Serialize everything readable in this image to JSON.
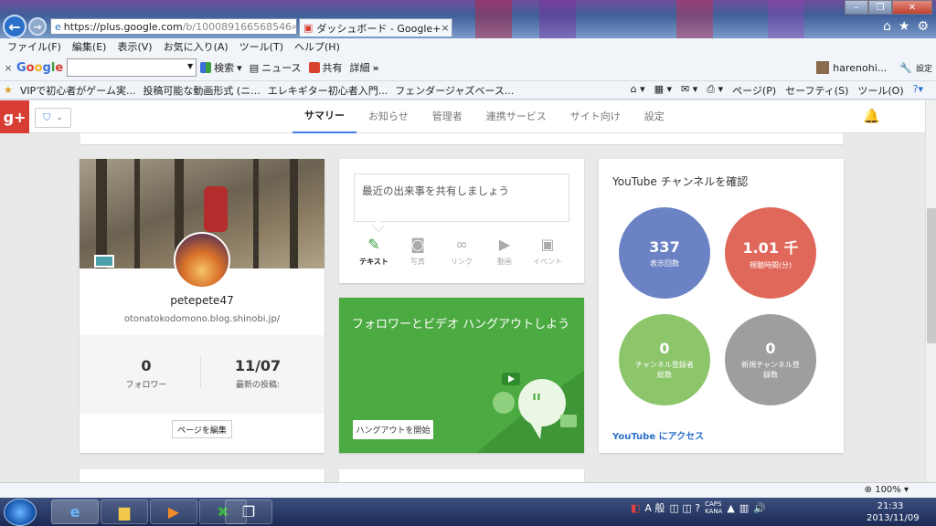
{
  "browser": {
    "address_url_main": "https://plus.google.com",
    "address_url_rest": "/b/100089166568546",
    "tab_title": "ダッシュボード - Google+",
    "menu": [
      "ファイル(F)",
      "編集(E)",
      "表示(V)",
      "お気に入り(A)",
      "ツール(T)",
      "ヘルプ(H)"
    ],
    "toolbar": {
      "search_label": "検索",
      "news_label": "ニュース",
      "share_label": "共有",
      "details_label": "詳細",
      "more": "»",
      "username": "harenohi...",
      "settings_label": "設定"
    },
    "favorites": [
      "VIPで初心者がゲーム実...",
      "投稿可能な動画形式 (ニ...",
      "エレキギター初心者入門...",
      "フェンダージャズベース..."
    ],
    "command_bar": [
      "ページ(P)",
      "セーフティ(S)",
      "ツール(O)"
    ],
    "zoom": "100%"
  },
  "gplus": {
    "logo": "g+",
    "tabs": [
      "サマリー",
      "お知らせ",
      "管理者",
      "連携サービス",
      "サイト向け",
      "設定"
    ],
    "profile": {
      "name": "petepete47",
      "url": "otonatokodomono.blog.shinobi.jp/",
      "followers_value": "0",
      "followers_label": "フォロワー",
      "last_post_value": "11/07",
      "last_post_label": "最新の投稿:",
      "edit_button": "ページを編集"
    },
    "share": {
      "placeholder": "最近の出来事を共有しましょう",
      "items": [
        "テキスト",
        "写真",
        "リンク",
        "動画",
        "イベント"
      ]
    },
    "hangout": {
      "title": "フォロワーとビデオ ハングアウトしよう",
      "button": "ハングアウトを開始"
    },
    "youtube": {
      "title": "YouTube チャンネルを確認",
      "stats": [
        {
          "value": "337",
          "label": "表示回数",
          "color": "#6b82c4"
        },
        {
          "value": "1.01 千",
          "label": "視聴時間(分)",
          "color": "#e0685a"
        },
        {
          "value": "0",
          "label": "チャンネル登録者\n総数",
          "color": "#8cc56a"
        },
        {
          "value": "0",
          "label": "新規チャンネル登\n録数",
          "color": "#9e9e9e"
        }
      ],
      "link": "YouTube にアクセス"
    }
  },
  "taskbar": {
    "time": "21:33",
    "date": "2013/11/09"
  }
}
